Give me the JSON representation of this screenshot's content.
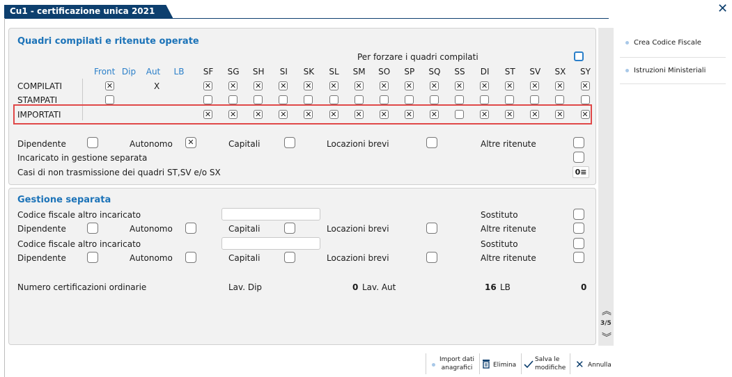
{
  "window": {
    "title": "Cu1 - certificazione unica 2021",
    "close": "✕"
  },
  "section1": {
    "title": "Quadri compilati e ritenute operate",
    "force_label": "Per forzare i quadri compilati",
    "columns_blue": [
      "Front",
      "Dip",
      "Aut",
      "LB"
    ],
    "columns": [
      "SF",
      "SG",
      "SH",
      "SI",
      "SK",
      "SL",
      "SM",
      "SO",
      "SP",
      "SQ",
      "SS",
      "DI",
      "ST",
      "SV",
      "SX",
      "SY"
    ],
    "rows": {
      "compilati": {
        "label": "COMPILATI",
        "front": "✕",
        "aut": "X",
        "cells": [
          "✕",
          "✕",
          "✕",
          "✕",
          "✕",
          "✕",
          "✕",
          "✕",
          "✕",
          "✕",
          "✕",
          "✕",
          "✕",
          "✕",
          "✕",
          "✕"
        ]
      },
      "stampati": {
        "label": "STAMPATI",
        "cells": [
          "",
          "",
          "",
          "",
          "",
          "",
          "",
          "",
          "",
          "",
          "",
          "",
          "",
          "",
          "",
          ""
        ]
      },
      "importati": {
        "label": "IMPORTATI",
        "cells": [
          "✕",
          "✕",
          "✕",
          "✕",
          "✕",
          "✕",
          "✕",
          "✕",
          "✕",
          "✕",
          "",
          "✕",
          "✕",
          "✕",
          "✕",
          "✕"
        ]
      }
    },
    "dipendente": "Dipendente",
    "autonomo": "Autonomo",
    "autonomo_value": "✕",
    "capitali": "Capitali",
    "locazioni": "Locazioni brevi",
    "altre": "Altre ritenute",
    "incaricato": "Incaricato in gestione separata",
    "casi": "Casi di non trasmissione dei quadri ST,SV e/o SX",
    "casi_value": "0"
  },
  "section2": {
    "title": "Gestione separata",
    "codice1": "Codice fiscale altro incaricato",
    "codice2": "Codice fiscale altro incaricato",
    "sostituto": "Sostituto",
    "dipendente": "Dipendente",
    "autonomo": "Autonomo",
    "capitali": "Capitali",
    "locazioni": "Locazioni brevi",
    "altre": "Altre ritenute",
    "numero": "Numero certificazioni ordinarie",
    "lav_dip": "Lav. Dip",
    "lav_dip_value": "0",
    "lav_aut": "Lav. Aut",
    "lav_aut_value": "16",
    "lb": "LB",
    "lb_value": "0"
  },
  "scroll": {
    "page": "3/5"
  },
  "sidebar": {
    "items": [
      "Crea Codice Fiscale",
      "Istruzioni Ministeriali"
    ]
  },
  "footer": {
    "import_l1": "Import dati",
    "import_l2": "anagrafici",
    "elimina": "Elimina",
    "salva_l1": "Salva le",
    "salva_l2": "modifiche",
    "annulla": "Annulla"
  },
  "colors": {
    "title_bg": "#0d3f6e",
    "section_title": "#1c73b8",
    "highlight": "#e04848"
  }
}
